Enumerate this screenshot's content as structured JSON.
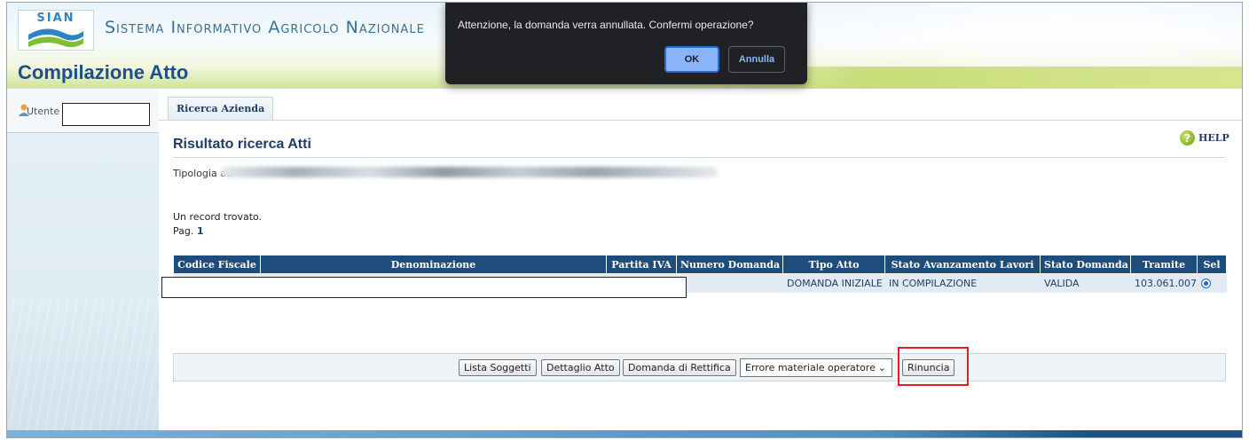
{
  "header": {
    "logo_text": "SIAN",
    "system_title": "Sistema Informativo Agricolo Nazionale",
    "page_title": "Compilazione Atto"
  },
  "dialog": {
    "message": "Attenzione, la domanda verra annullata. Confermi operazione?",
    "ok_label": "OK",
    "cancel_label": "Annulla"
  },
  "sidebar": {
    "user_label": "Utente",
    "user_value": ""
  },
  "tabs": [
    {
      "label": "Ricerca Azienda"
    }
  ],
  "help_label": "HELP",
  "section_title": "Risultato ricerca Atti",
  "tipologia_label": "Tipologia at:",
  "record_info": "Un record trovato.",
  "pagination": {
    "label": "Pag.",
    "current": "1"
  },
  "table": {
    "columns": [
      "Codice Fiscale",
      "Denominazione",
      "Partita IVA",
      "Numero Domanda",
      "Tipo Atto",
      "Stato Avanzamento Lavori",
      "Stato Domanda",
      "Tramite",
      "Sel"
    ],
    "rows": [
      {
        "codice_fiscale": "",
        "denominazione": "",
        "partita_iva": "",
        "numero_domanda": "",
        "tipo_atto": "DOMANDA INIZIALE",
        "stato_avanzamento": "IN COMPILAZIONE",
        "stato_domanda": "VALIDA",
        "tramite": "103.061.007",
        "selected": true
      }
    ]
  },
  "actions": {
    "lista_soggetti": "Lista Soggetti",
    "dettaglio_atto": "Dettaglio Atto",
    "domanda_rettifica": "Domanda di Rettifica",
    "motivo_selected": "Errore materiale operatore",
    "rinuncia": "Rinuncia"
  },
  "colors": {
    "header_blue": "#1e4d7b",
    "title_blue": "#1f4f8a",
    "highlight_red": "#e02020",
    "dialog_bg": "#202124",
    "dialog_ok": "#8ab4f8"
  }
}
